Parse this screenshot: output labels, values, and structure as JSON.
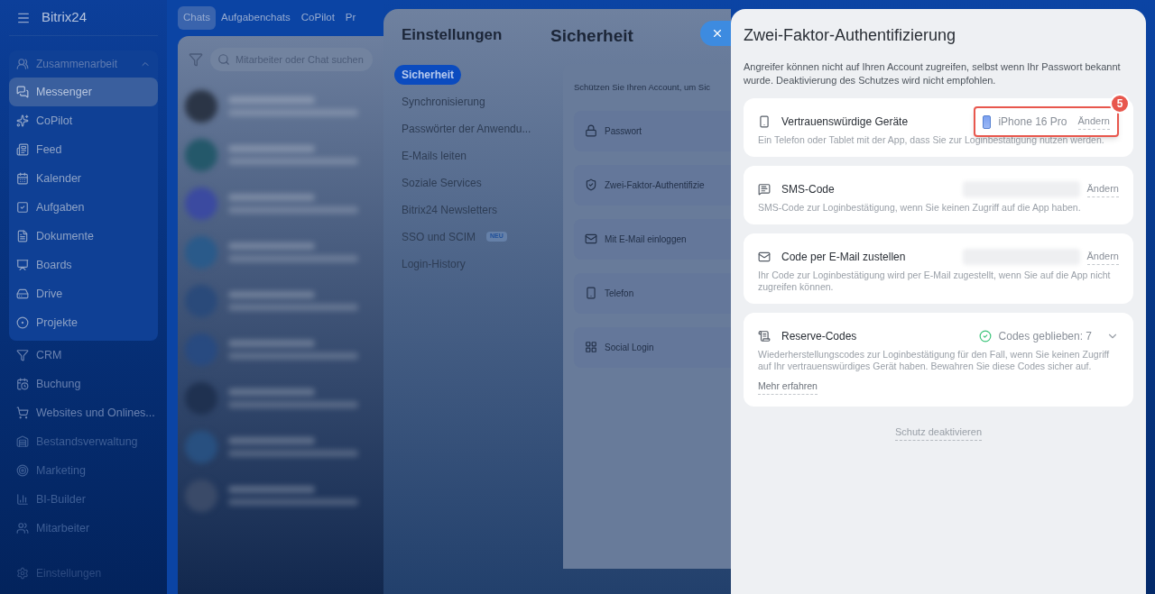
{
  "sidebar": {
    "logo": "Bitrix24",
    "group": {
      "label": "Zusammenarbeit",
      "expanded": true
    },
    "items": [
      {
        "label": "Messenger",
        "selected": true
      },
      {
        "label": "CoPilot",
        "selected": false
      },
      {
        "label": "Feed",
        "selected": false
      },
      {
        "label": "Kalender",
        "selected": false
      },
      {
        "label": "Aufgaben",
        "selected": false
      },
      {
        "label": "Dokumente",
        "selected": false
      },
      {
        "label": "Boards",
        "selected": false
      },
      {
        "label": "Drive",
        "selected": false
      },
      {
        "label": "Projekte",
        "selected": false
      },
      {
        "label": "CRM",
        "selected": false
      },
      {
        "label": "Buchung",
        "selected": false
      },
      {
        "label": "Websites und Onlines...",
        "selected": false
      },
      {
        "label": "Bestandsverwaltung",
        "selected": false
      },
      {
        "label": "Marketing",
        "selected": false
      },
      {
        "label": "BI-Builder",
        "selected": false
      },
      {
        "label": "Mitarbeiter",
        "selected": false
      }
    ],
    "footer": "Einstellungen"
  },
  "chat": {
    "tabs": [
      {
        "label": "Chats",
        "selected": true
      },
      {
        "label": "Aufgabenchats",
        "selected": false
      },
      {
        "label": "CoPilot",
        "selected": false
      },
      {
        "label": "Pr",
        "selected": false
      }
    ],
    "search": {
      "placeholder": "Mitarbeiter oder Chat suchen"
    }
  },
  "settings": {
    "title": "Einstellungen",
    "menu": [
      {
        "label": "Sicherheit",
        "selected": true
      },
      {
        "label": "Synchronisierung",
        "selected": false
      },
      {
        "label": "Passwörter der Anwendu...",
        "selected": false
      },
      {
        "label": "E-Mails leiten",
        "selected": false
      },
      {
        "label": "Soziale Services",
        "selected": false
      },
      {
        "label": "Bitrix24 Newsletters",
        "selected": false
      },
      {
        "label": "SSO und SCIM",
        "selected": false,
        "badge": "NEU"
      },
      {
        "label": "Login-History",
        "selected": false
      }
    ],
    "section_title": "Sicherheit",
    "intro": "Schützen Sie Ihren Account, um Sic",
    "items": [
      "Passwort",
      "Zwei-Faktor-Authentifizie",
      "Mit E-Mail einloggen",
      "Telefon",
      "Social Login"
    ]
  },
  "two_factor": {
    "title": "Zwei-Faktor-Authentifizierung",
    "description": "Angreifer können nicht auf Ihren Account zugreifen, selbst wenn Ihr Passwort bekannt wurde. Deaktivierung des Schutzes wird nicht empfohlen.",
    "methods": [
      {
        "kind": "device",
        "title": "Vertrauenswürdige Geräte",
        "value": "iPhone 16 Pro",
        "action": "Ändern",
        "description": "Ein Telefon oder Tablet mit der App, dass Sie zur Loginbestätigung nutzen werden.",
        "annotation": "5"
      },
      {
        "kind": "sms",
        "title": "SMS-Code",
        "action": "Ändern",
        "description": "SMS-Code zur Loginbestätigung, wenn Sie keinen Zugriff auf die App haben."
      },
      {
        "kind": "email",
        "title": "Code per E-Mail zustellen",
        "action": "Ändern",
        "description": "Ihr Code zur Loginbestätigung wird per E-Mail zugestellt, wenn Sie auf die App nicht zugreifen können."
      },
      {
        "kind": "codes",
        "title": "Reserve-Codes",
        "status": "Codes geblieben: 7",
        "description": "Wiederherstellungscodes zur Loginbestätigung für den Fall, wenn Sie keinen Zugriff auf Ihr vertrauenswürdiges Gerät haben. Bewahren Sie diese Codes sicher auf.",
        "link": "Mehr erfahren"
      }
    ],
    "deactivate": "Schutz deaktivieren"
  }
}
